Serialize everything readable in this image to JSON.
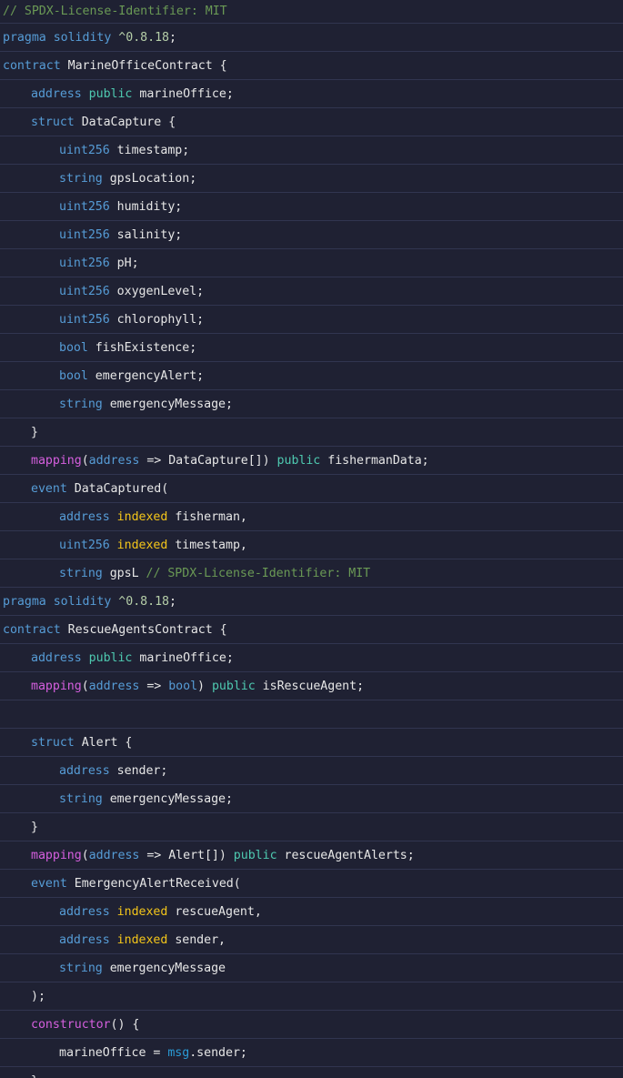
{
  "editor": {
    "lines": [
      {
        "indent": 0,
        "tokens": [
          {
            "t": "// SPDX-License-Identifier: MIT",
            "k": "comment"
          }
        ]
      },
      {
        "indent": 0,
        "tokens": [
          {
            "t": "pragma solidity ",
            "k": "kw"
          },
          {
            "t": "^0.8.18",
            "k": "num"
          },
          {
            "t": ";",
            "k": "plain"
          }
        ]
      },
      {
        "indent": 0,
        "tokens": [
          {
            "t": "contract ",
            "k": "kw"
          },
          {
            "t": "MarineOfficeContract {",
            "k": "plain"
          }
        ]
      },
      {
        "indent": 1,
        "tokens": [
          {
            "t": "address ",
            "k": "type"
          },
          {
            "t": "public ",
            "k": "pub"
          },
          {
            "t": "marineOffice;",
            "k": "plain"
          }
        ]
      },
      {
        "indent": 1,
        "tokens": [
          {
            "t": "struct ",
            "k": "kw"
          },
          {
            "t": "DataCapture {",
            "k": "plain"
          }
        ]
      },
      {
        "indent": 2,
        "tokens": [
          {
            "t": "uint256 ",
            "k": "type"
          },
          {
            "t": "timestamp;",
            "k": "plain"
          }
        ]
      },
      {
        "indent": 2,
        "tokens": [
          {
            "t": "string ",
            "k": "type"
          },
          {
            "t": "gpsLocation;",
            "k": "plain"
          }
        ]
      },
      {
        "indent": 2,
        "tokens": [
          {
            "t": "uint256 ",
            "k": "type"
          },
          {
            "t": "humidity;",
            "k": "plain"
          }
        ]
      },
      {
        "indent": 2,
        "tokens": [
          {
            "t": "uint256 ",
            "k": "type"
          },
          {
            "t": "salinity;",
            "k": "plain"
          }
        ]
      },
      {
        "indent": 2,
        "tokens": [
          {
            "t": "uint256 ",
            "k": "type"
          },
          {
            "t": "pH;",
            "k": "plain"
          }
        ]
      },
      {
        "indent": 2,
        "tokens": [
          {
            "t": "uint256 ",
            "k": "type"
          },
          {
            "t": "oxygenLevel;",
            "k": "plain"
          }
        ]
      },
      {
        "indent": 2,
        "tokens": [
          {
            "t": "uint256 ",
            "k": "type"
          },
          {
            "t": "chlorophyll;",
            "k": "plain"
          }
        ]
      },
      {
        "indent": 2,
        "tokens": [
          {
            "t": "bool ",
            "k": "type"
          },
          {
            "t": "fishExistence;",
            "k": "plain"
          }
        ]
      },
      {
        "indent": 2,
        "tokens": [
          {
            "t": "bool ",
            "k": "type"
          },
          {
            "t": "emergencyAlert;",
            "k": "plain"
          }
        ]
      },
      {
        "indent": 2,
        "tokens": [
          {
            "t": "string ",
            "k": "type"
          },
          {
            "t": "emergencyMessage;",
            "k": "plain"
          }
        ]
      },
      {
        "indent": 1,
        "tokens": [
          {
            "t": "}",
            "k": "plain"
          }
        ]
      },
      {
        "indent": 1,
        "tokens": [
          {
            "t": "mapping",
            "k": "fn"
          },
          {
            "t": "(",
            "k": "plain"
          },
          {
            "t": "address",
            "k": "type"
          },
          {
            "t": " => DataCapture[]) ",
            "k": "plain"
          },
          {
            "t": "public ",
            "k": "pub"
          },
          {
            "t": "fishermanData;",
            "k": "plain"
          }
        ]
      },
      {
        "indent": 1,
        "tokens": [
          {
            "t": "event ",
            "k": "kw"
          },
          {
            "t": "DataCaptured(",
            "k": "plain"
          }
        ]
      },
      {
        "indent": 2,
        "tokens": [
          {
            "t": "address ",
            "k": "type"
          },
          {
            "t": "indexed ",
            "k": "idx"
          },
          {
            "t": "fisherman,",
            "k": "plain"
          }
        ]
      },
      {
        "indent": 2,
        "tokens": [
          {
            "t": "uint256 ",
            "k": "type"
          },
          {
            "t": "indexed ",
            "k": "idx"
          },
          {
            "t": "timestamp,",
            "k": "plain"
          }
        ]
      },
      {
        "indent": 2,
        "tokens": [
          {
            "t": "string ",
            "k": "type"
          },
          {
            "t": "gpsL ",
            "k": "plain"
          },
          {
            "t": "// SPDX-License-Identifier: MIT",
            "k": "comment"
          }
        ]
      },
      {
        "indent": 0,
        "tokens": [
          {
            "t": "pragma solidity ",
            "k": "kw"
          },
          {
            "t": "^0.8.18",
            "k": "num"
          },
          {
            "t": ";",
            "k": "plain"
          }
        ]
      },
      {
        "indent": 0,
        "tokens": [
          {
            "t": "contract ",
            "k": "kw"
          },
          {
            "t": "RescueAgentsContract {",
            "k": "plain"
          }
        ]
      },
      {
        "indent": 1,
        "tokens": [
          {
            "t": "address ",
            "k": "type"
          },
          {
            "t": "public ",
            "k": "pub"
          },
          {
            "t": "marineOffice;",
            "k": "plain"
          }
        ]
      },
      {
        "indent": 1,
        "tokens": [
          {
            "t": "mapping",
            "k": "fn"
          },
          {
            "t": "(",
            "k": "plain"
          },
          {
            "t": "address",
            "k": "type"
          },
          {
            "t": " => ",
            "k": "plain"
          },
          {
            "t": "bool",
            "k": "type"
          },
          {
            "t": ") ",
            "k": "plain"
          },
          {
            "t": "public ",
            "k": "pub"
          },
          {
            "t": "isRescueAgent;",
            "k": "plain"
          }
        ]
      },
      {
        "indent": 0,
        "tokens": []
      },
      {
        "indent": 1,
        "tokens": [
          {
            "t": "struct ",
            "k": "kw"
          },
          {
            "t": "Alert {",
            "k": "plain"
          }
        ]
      },
      {
        "indent": 2,
        "tokens": [
          {
            "t": "address ",
            "k": "type"
          },
          {
            "t": "sender;",
            "k": "plain"
          }
        ]
      },
      {
        "indent": 2,
        "tokens": [
          {
            "t": "string ",
            "k": "type"
          },
          {
            "t": "emergencyMessage;",
            "k": "plain"
          }
        ]
      },
      {
        "indent": 1,
        "tokens": [
          {
            "t": "}",
            "k": "plain"
          }
        ]
      },
      {
        "indent": 1,
        "tokens": [
          {
            "t": "mapping",
            "k": "fn"
          },
          {
            "t": "(",
            "k": "plain"
          },
          {
            "t": "address",
            "k": "type"
          },
          {
            "t": " => Alert[]) ",
            "k": "plain"
          },
          {
            "t": "public ",
            "k": "pub"
          },
          {
            "t": "rescueAgentAlerts;",
            "k": "plain"
          }
        ]
      },
      {
        "indent": 1,
        "tokens": [
          {
            "t": "event ",
            "k": "kw"
          },
          {
            "t": "EmergencyAlertReceived(",
            "k": "plain"
          }
        ]
      },
      {
        "indent": 2,
        "tokens": [
          {
            "t": "address ",
            "k": "type"
          },
          {
            "t": "indexed ",
            "k": "idx"
          },
          {
            "t": "rescueAgent,",
            "k": "plain"
          }
        ]
      },
      {
        "indent": 2,
        "tokens": [
          {
            "t": "address ",
            "k": "type"
          },
          {
            "t": "indexed ",
            "k": "idx"
          },
          {
            "t": "sender,",
            "k": "plain"
          }
        ]
      },
      {
        "indent": 2,
        "tokens": [
          {
            "t": "string ",
            "k": "type"
          },
          {
            "t": "emergencyMessage",
            "k": "plain"
          }
        ]
      },
      {
        "indent": 1,
        "tokens": [
          {
            "t": ");",
            "k": "plain"
          }
        ]
      },
      {
        "indent": 1,
        "tokens": [
          {
            "t": "constructor",
            "k": "fn"
          },
          {
            "t": "() {",
            "k": "plain"
          }
        ]
      },
      {
        "indent": 2,
        "tokens": [
          {
            "t": "marineOffice = ",
            "k": "plain"
          },
          {
            "t": "msg",
            "k": "msg"
          },
          {
            "t": ".sender;",
            "k": "plain"
          }
        ]
      },
      {
        "indent": 1,
        "tokens": [
          {
            "t": "}",
            "k": "plain"
          }
        ]
      }
    ]
  }
}
